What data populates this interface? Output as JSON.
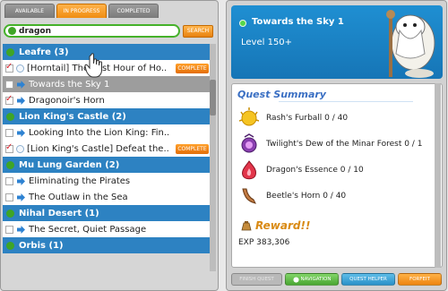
{
  "tabs": [
    {
      "label": "Available",
      "active": false
    },
    {
      "label": "In Progress",
      "active": true
    },
    {
      "label": "Completed",
      "active": false
    }
  ],
  "search": {
    "value": "dragon",
    "button_label": "Search"
  },
  "quest_list": [
    {
      "type": "header",
      "label": "Leafre (3)"
    },
    {
      "type": "quest",
      "label": "[Horntail] The Last Hour of Ho..",
      "checked": true,
      "complete": true,
      "icon": "radio"
    },
    {
      "type": "quest",
      "label": "Towards the Sky 1",
      "checked": false,
      "complete": false,
      "icon": "arrow",
      "selected": true
    },
    {
      "type": "quest",
      "label": "Dragonoir's Horn",
      "checked": true,
      "complete": false,
      "icon": "arrow"
    },
    {
      "type": "header",
      "label": "Lion King's Castle (2)"
    },
    {
      "type": "quest",
      "label": "Looking Into the Lion King: Fin..",
      "checked": false,
      "complete": false,
      "icon": "arrow"
    },
    {
      "type": "quest",
      "label": "[Lion King's Castle] Defeat the..",
      "checked": true,
      "complete": true,
      "icon": "radio"
    },
    {
      "type": "header",
      "label": "Mu Lung Garden (2)"
    },
    {
      "type": "quest",
      "label": "Eliminating the Pirates",
      "checked": false,
      "complete": false,
      "icon": "arrow"
    },
    {
      "type": "quest",
      "label": "The Outlaw in the Sea",
      "checked": false,
      "complete": false,
      "icon": "arrow"
    },
    {
      "type": "header",
      "label": "Nihal Desert (1)"
    },
    {
      "type": "quest",
      "label": "The Secret, Quiet Passage",
      "checked": false,
      "complete": false,
      "icon": "arrow"
    },
    {
      "type": "header",
      "label": "Orbis (1)"
    }
  ],
  "complete_badge": "Complete",
  "detail": {
    "title": "Towards the Sky 1",
    "level": "Level 150+",
    "summary_title": "Quest Summary",
    "items": [
      {
        "name": "Rash's Furball 0 / 40",
        "icon": "furball-icon"
      },
      {
        "name": "Twilight's Dew of the Minar Forest 0 / 1",
        "icon": "dew-icon"
      },
      {
        "name": "Dragon's Essence 0 / 10",
        "icon": "essence-icon"
      },
      {
        "name": "Beetle's Horn 0 / 40",
        "icon": "horn-icon"
      }
    ],
    "reward_title": "Reward!!",
    "exp": "EXP 383,306"
  },
  "buttons": {
    "finish": "Finish Quest",
    "navigation": "Navigation",
    "helper": "Quest Helper",
    "forfeit": "Forfeit"
  },
  "colors": {
    "header_blue": "#2d82c2",
    "accent_orange": "#f08d12",
    "search_green": "#45b12a",
    "detail_blue": "#1f8fd2"
  }
}
